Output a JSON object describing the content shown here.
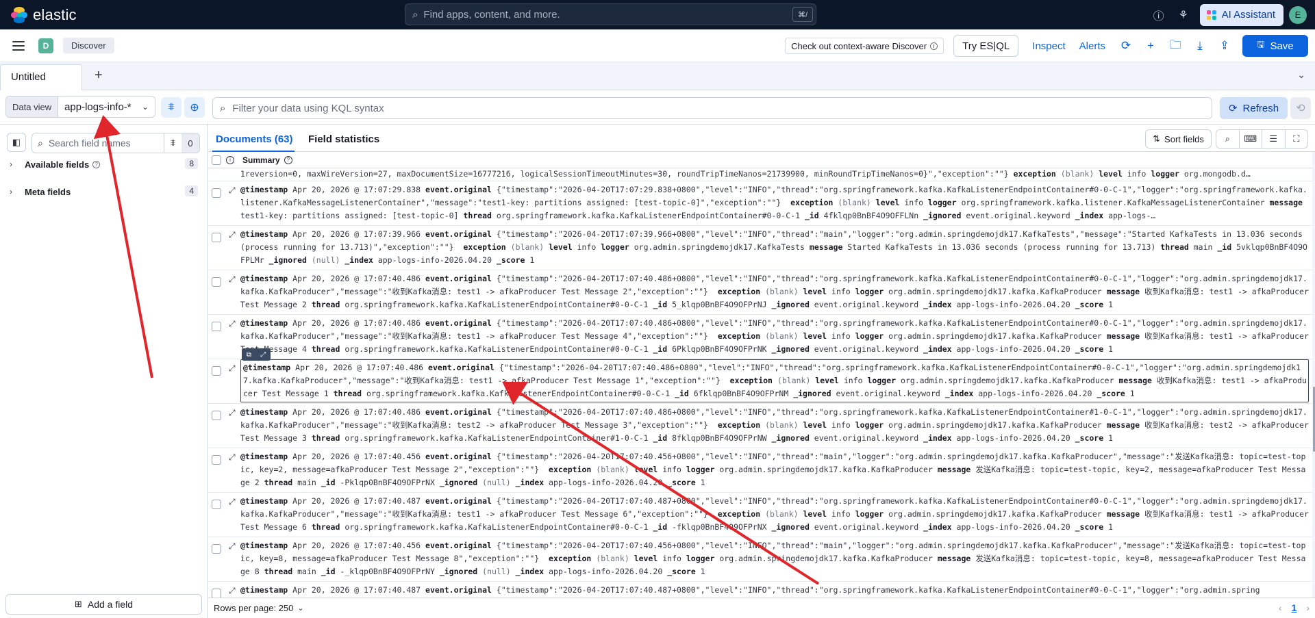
{
  "header": {
    "brand": "elastic",
    "search_placeholder": "Find apps, content, and more.",
    "search_shortcut": "⌘/",
    "ai_assistant_label": "AI Assistant",
    "avatar_initial": "E"
  },
  "toolbar": {
    "space_initial": "D",
    "breadcrumb": "Discover",
    "context_aware_label": "Check out context-aware Discover",
    "try_esql_label": "Try ES|QL",
    "inspect_label": "Inspect",
    "alerts_label": "Alerts",
    "save_label": "Save"
  },
  "tabs": {
    "active_tab": "Untitled",
    "add_icon": "+"
  },
  "query": {
    "data_view_label": "Data view",
    "data_view_value": "app-logs-info-*",
    "kql_placeholder": "Filter your data using KQL syntax",
    "refresh_label": "Refresh"
  },
  "sidebar": {
    "search_placeholder": "Search field names",
    "filter_count": "0",
    "groups": [
      {
        "label": "Available fields",
        "count": "8"
      },
      {
        "label": "Meta fields",
        "count": "4"
      }
    ],
    "add_field_label": "Add a field"
  },
  "main": {
    "tabs": [
      {
        "label": "Documents (63)"
      },
      {
        "label": "Field statistics"
      }
    ],
    "sort_label": "Sort fields",
    "summary_label": "Summary"
  },
  "rows": [
    {
      "parts": [
        [
          "t",
          "1reversion=0, maxWireVersion=27, maxDocumentSize=16777216, logicalSessionTimeoutMinutes=30, roundTripTimeNanos=21739900, minRoundTripTimeNanos=0}\",\"exception\":\"\"} "
        ],
        [
          "b",
          "exception"
        ],
        [
          "t",
          " "
        ],
        [
          "g",
          "(blank)"
        ],
        [
          "t",
          " "
        ],
        [
          "b",
          "level"
        ],
        [
          "t",
          " info "
        ],
        [
          "b",
          "logger"
        ],
        [
          "t",
          " org.mongodb.d…"
        ]
      ]
    },
    {
      "parts": [
        [
          "b",
          "@timestamp"
        ],
        [
          "t",
          " Apr 20, 2026 @ 17:07:29.838 "
        ],
        [
          "b",
          "event.original"
        ],
        [
          "t",
          " {\"timestamp\":\"2026-04-20T17:07:29.838+0800\",\"level\":\"INFO\",\"thread\":\"org.springframework.kafka.KafkaListenerEndpointContainer#0-0-C-1\",\"logger\":\"org.springframework.kafka.listener.KafkaMessageListenerContainer\",\"message\":\"test1-key: partitions assigned: [test-topic-0]\",\"exception\":\"\"}  "
        ],
        [
          "b",
          "exception"
        ],
        [
          "t",
          " "
        ],
        [
          "g",
          "(blank)"
        ],
        [
          "t",
          " "
        ],
        [
          "b",
          "level"
        ],
        [
          "t",
          " info "
        ],
        [
          "b",
          "logger"
        ],
        [
          "t",
          " org.springframework.kafka.listener.KafkaMessageListenerContainer "
        ],
        [
          "b",
          "message"
        ],
        [
          "t",
          " test1-key: partitions assigned: [test-topic-0] "
        ],
        [
          "b",
          "thread"
        ],
        [
          "t",
          " org.springframework.kafka.KafkaListenerEndpointContainer#0-0-C-1 "
        ],
        [
          "b",
          "_id"
        ],
        [
          "t",
          " 4fklqp0BnBF4O9OFFLNn "
        ],
        [
          "b",
          "_ignored"
        ],
        [
          "t",
          " event.original.keyword "
        ],
        [
          "b",
          "_index"
        ],
        [
          "t",
          " app-logs-…"
        ]
      ]
    },
    {
      "parts": [
        [
          "b",
          "@timestamp"
        ],
        [
          "t",
          " Apr 20, 2026 @ 17:07:39.966 "
        ],
        [
          "b",
          "event.original"
        ],
        [
          "t",
          " {\"timestamp\":\"2026-04-20T17:07:39.966+0800\",\"level\":\"INFO\",\"thread\":\"main\",\"logger\":\"org.admin.springdemojdk17.KafkaTests\",\"message\":\"Started KafkaTests in 13.036 seconds (process running for 13.713)\",\"exception\":\"\"}  "
        ],
        [
          "b",
          "exception"
        ],
        [
          "t",
          " "
        ],
        [
          "g",
          "(blank)"
        ],
        [
          "t",
          " "
        ],
        [
          "b",
          "level"
        ],
        [
          "t",
          " info "
        ],
        [
          "b",
          "logger"
        ],
        [
          "t",
          " org.admin.springdemojdk17.KafkaTests "
        ],
        [
          "b",
          "message"
        ],
        [
          "t",
          " Started KafkaTests in 13.036 seconds (process running for 13.713) "
        ],
        [
          "b",
          "thread"
        ],
        [
          "t",
          " main "
        ],
        [
          "b",
          "_id"
        ],
        [
          "t",
          " 5vklqp0BnBF4O9OFPLMr "
        ],
        [
          "b",
          "_ignored"
        ],
        [
          "t",
          " "
        ],
        [
          "g",
          "(null)"
        ],
        [
          "t",
          " "
        ],
        [
          "b",
          "_index"
        ],
        [
          "t",
          " app-logs-info-2026.04.20 "
        ],
        [
          "b",
          "_score"
        ],
        [
          "t",
          " 1"
        ]
      ]
    },
    {
      "parts": [
        [
          "b",
          "@timestamp"
        ],
        [
          "t",
          " Apr 20, 2026 @ 17:07:40.486 "
        ],
        [
          "b",
          "event.original"
        ],
        [
          "t",
          " {\"timestamp\":\"2026-04-20T17:07:40.486+0800\",\"level\":\"INFO\",\"thread\":\"org.springframework.kafka.KafkaListenerEndpointContainer#0-0-C-1\",\"logger\":\"org.admin.springdemojdk17.kafka.KafkaProducer\",\"message\":\"收到Kafka消息: test1 -> afkaProducer Test Message 2\",\"exception\":\"\"}  "
        ],
        [
          "b",
          "exception"
        ],
        [
          "t",
          " "
        ],
        [
          "g",
          "(blank)"
        ],
        [
          "t",
          " "
        ],
        [
          "b",
          "level"
        ],
        [
          "t",
          " info "
        ],
        [
          "b",
          "logger"
        ],
        [
          "t",
          " org.admin.springdemojdk17.kafka.KafkaProducer "
        ],
        [
          "b",
          "message"
        ],
        [
          "t",
          " 收到Kafka消息: test1 -> afkaProducer Test Message 2 "
        ],
        [
          "b",
          "thread"
        ],
        [
          "t",
          " org.springframework.kafka.KafkaListenerEndpointContainer#0-0-C-1 "
        ],
        [
          "b",
          "_id"
        ],
        [
          "t",
          " 5_klqp0BnBF4O9OFPrNJ "
        ],
        [
          "b",
          "_ignored"
        ],
        [
          "t",
          " event.original.keyword "
        ],
        [
          "b",
          "_index"
        ],
        [
          "t",
          " app-logs-info-2026.04.20 "
        ],
        [
          "b",
          "_score"
        ],
        [
          "t",
          " 1"
        ]
      ]
    },
    {
      "parts": [
        [
          "b",
          "@timestamp"
        ],
        [
          "t",
          " Apr 20, 2026 @ 17:07:40.486 "
        ],
        [
          "b",
          "event.original"
        ],
        [
          "t",
          " {\"timestamp\":\"2026-04-20T17:07:40.486+0800\",\"level\":\"INFO\",\"thread\":\"org.springframework.kafka.KafkaListenerEndpointContainer#0-0-C-1\",\"logger\":\"org.admin.springdemojdk17.kafka.KafkaProducer\",\"message\":\"收到Kafka消息: test1 -> afkaProducer Test Message 4\",\"exception\":\"\"}  "
        ],
        [
          "b",
          "exception"
        ],
        [
          "t",
          " "
        ],
        [
          "g",
          "(blank)"
        ],
        [
          "t",
          " "
        ],
        [
          "b",
          "level"
        ],
        [
          "t",
          " info "
        ],
        [
          "b",
          "logger"
        ],
        [
          "t",
          " org.admin.springdemojdk17.kafka.KafkaProducer "
        ],
        [
          "b",
          "message"
        ],
        [
          "t",
          " 收到Kafka消息: test1 -> afkaProducer Test Message 4 "
        ],
        [
          "b",
          "thread"
        ],
        [
          "t",
          " org.springframework.kafka.KafkaListenerEndpointContainer#0-0-C-1 "
        ],
        [
          "b",
          "_id"
        ],
        [
          "t",
          " 6Pklqp0BnBF4O9OFPrNK "
        ],
        [
          "b",
          "_ignored"
        ],
        [
          "t",
          " event.original.keyword "
        ],
        [
          "b",
          "_index"
        ],
        [
          "t",
          " app-logs-info-2026.04.20 "
        ],
        [
          "b",
          "_score"
        ],
        [
          "t",
          " 1"
        ]
      ]
    },
    {
      "focused": true,
      "parts": [
        [
          "b",
          "@timestamp"
        ],
        [
          "t",
          " Apr 20, 2026 @ 17:07:40.486 "
        ],
        [
          "b",
          "event.original"
        ],
        [
          "t",
          " {\"timestamp\":\"2026-04-20T17:07:40.486+0800\",\"level\":\"INFO\",\"thread\":\"org.springframework.kafka.KafkaListenerEndpointContainer#0-0-C-1\",\"logger\":\"org.admin.springdemojdk17.kafka.KafkaProducer\",\"message\":\"收到Kafka消息: test1 -> afkaProducer Test Message 1\",\"exception\":\"\"}  "
        ],
        [
          "b",
          "exception"
        ],
        [
          "t",
          " "
        ],
        [
          "g",
          "(blank)"
        ],
        [
          "t",
          " "
        ],
        [
          "b",
          "level"
        ],
        [
          "t",
          " info "
        ],
        [
          "b",
          "logger"
        ],
        [
          "t",
          " org.admin.springdemojdk17.kafka.KafkaProducer "
        ],
        [
          "b",
          "message"
        ],
        [
          "t",
          " 收到Kafka消息: test1 -> afkaProducer Test Message 1 "
        ],
        [
          "b",
          "thread"
        ],
        [
          "t",
          " org.springframework.kafka.KafkaListenerEndpointContainer#0-0-C-1 "
        ],
        [
          "b",
          "_id"
        ],
        [
          "t",
          " 6fklqp0BnBF4O9OFPrNM "
        ],
        [
          "b",
          "_ignored"
        ],
        [
          "t",
          " event.original.keyword "
        ],
        [
          "b",
          "_index"
        ],
        [
          "t",
          " app-logs-info-2026.04.20 "
        ],
        [
          "b",
          "_score"
        ],
        [
          "t",
          " 1"
        ]
      ]
    },
    {
      "parts": [
        [
          "b",
          "@timestamp"
        ],
        [
          "t",
          " Apr 20, 2026 @ 17:07:40.486 "
        ],
        [
          "b",
          "event.original"
        ],
        [
          "t",
          " {\"timestamp\":\"2026-04-20T17:07:40.486+0800\",\"level\":\"INFO\",\"thread\":\"org.springframework.kafka.KafkaListenerEndpointContainer#1-0-C-1\",\"logger\":\"org.admin.springdemojdk17.kafka.KafkaProducer\",\"message\":\"收到Kafka消息: test2 -> afkaProducer Test Message 3\",\"exception\":\"\"}  "
        ],
        [
          "b",
          "exception"
        ],
        [
          "t",
          " "
        ],
        [
          "g",
          "(blank)"
        ],
        [
          "t",
          " "
        ],
        [
          "b",
          "level"
        ],
        [
          "t",
          " info "
        ],
        [
          "b",
          "logger"
        ],
        [
          "t",
          " org.admin.springdemojdk17.kafka.KafkaProducer "
        ],
        [
          "b",
          "message"
        ],
        [
          "t",
          " 收到Kafka消息: test2 -> afkaProducer Test Message 3 "
        ],
        [
          "b",
          "thread"
        ],
        [
          "t",
          " org.springframework.kafka.KafkaListenerEndpointContainer#1-0-C-1 "
        ],
        [
          "b",
          "_id"
        ],
        [
          "t",
          " 8fklqp0BnBF4O9OFPrNW "
        ],
        [
          "b",
          "_ignored"
        ],
        [
          "t",
          " event.original.keyword "
        ],
        [
          "b",
          "_index"
        ],
        [
          "t",
          " app-logs-info-2026.04.20 "
        ],
        [
          "b",
          "_score"
        ],
        [
          "t",
          " 1"
        ]
      ]
    },
    {
      "parts": [
        [
          "b",
          "@timestamp"
        ],
        [
          "t",
          " Apr 20, 2026 @ 17:07:40.456 "
        ],
        [
          "b",
          "event.original"
        ],
        [
          "t",
          " {\"timestamp\":\"2026-04-20T17:07:40.456+0800\",\"level\":\"INFO\",\"thread\":\"main\",\"logger\":\"org.admin.springdemojdk17.kafka.KafkaProducer\",\"message\":\"发送Kafka消息: topic=test-topic, key=2, message=afkaProducer Test Message 2\",\"exception\":\"\"}  "
        ],
        [
          "b",
          "exception"
        ],
        [
          "t",
          " "
        ],
        [
          "g",
          "(blank)"
        ],
        [
          "t",
          " "
        ],
        [
          "b",
          "level"
        ],
        [
          "t",
          " info "
        ],
        [
          "b",
          "logger"
        ],
        [
          "t",
          " org.admin.springdemojdk17.kafka.KafkaProducer "
        ],
        [
          "b",
          "message"
        ],
        [
          "t",
          " 发送Kafka消息: topic=test-topic, key=2, message=afkaProducer Test Message 2 "
        ],
        [
          "b",
          "thread"
        ],
        [
          "t",
          " main "
        ],
        [
          "b",
          "_id"
        ],
        [
          "t",
          " -Pklqp0BnBF4O9OFPrNX "
        ],
        [
          "b",
          "_ignored"
        ],
        [
          "t",
          " "
        ],
        [
          "g",
          "(null)"
        ],
        [
          "t",
          " "
        ],
        [
          "b",
          "_index"
        ],
        [
          "t",
          " app-logs-info-2026.04.20 "
        ],
        [
          "b",
          "_score"
        ],
        [
          "t",
          " 1"
        ]
      ]
    },
    {
      "parts": [
        [
          "b",
          "@timestamp"
        ],
        [
          "t",
          " Apr 20, 2026 @ 17:07:40.487 "
        ],
        [
          "b",
          "event.original"
        ],
        [
          "t",
          " {\"timestamp\":\"2026-04-20T17:07:40.487+0800\",\"level\":\"INFO\",\"thread\":\"org.springframework.kafka.KafkaListenerEndpointContainer#0-0-C-1\",\"logger\":\"org.admin.springdemojdk17.kafka.KafkaProducer\",\"message\":\"收到Kafka消息: test1 -> afkaProducer Test Message 6\",\"exception\":\"\"}  "
        ],
        [
          "b",
          "exception"
        ],
        [
          "t",
          " "
        ],
        [
          "g",
          "(blank)"
        ],
        [
          "t",
          " "
        ],
        [
          "b",
          "level"
        ],
        [
          "t",
          " info "
        ],
        [
          "b",
          "logger"
        ],
        [
          "t",
          " org.admin.springdemojdk17.kafka.KafkaProducer "
        ],
        [
          "b",
          "message"
        ],
        [
          "t",
          " 收到Kafka消息: test1 -> afkaProducer Test Message 6 "
        ],
        [
          "b",
          "thread"
        ],
        [
          "t",
          " org.springframework.kafka.KafkaListenerEndpointContainer#0-0-C-1 "
        ],
        [
          "b",
          "_id"
        ],
        [
          "t",
          " -fklqp0BnBF4O9OFPrNX "
        ],
        [
          "b",
          "_ignored"
        ],
        [
          "t",
          " event.original.keyword "
        ],
        [
          "b",
          "_index"
        ],
        [
          "t",
          " app-logs-info-2026.04.20 "
        ],
        [
          "b",
          "_score"
        ],
        [
          "t",
          " 1"
        ]
      ]
    },
    {
      "parts": [
        [
          "b",
          "@timestamp"
        ],
        [
          "t",
          " Apr 20, 2026 @ 17:07:40.456 "
        ],
        [
          "b",
          "event.original"
        ],
        [
          "t",
          " {\"timestamp\":\"2026-04-20T17:07:40.456+0800\",\"level\":\"INFO\",\"thread\":\"main\",\"logger\":\"org.admin.springdemojdk17.kafka.KafkaProducer\",\"message\":\"发送Kafka消息: topic=test-topic, key=8, message=afkaProducer Test Message 8\",\"exception\":\"\"}  "
        ],
        [
          "b",
          "exception"
        ],
        [
          "t",
          " "
        ],
        [
          "g",
          "(blank)"
        ],
        [
          "t",
          " "
        ],
        [
          "b",
          "level"
        ],
        [
          "t",
          " info "
        ],
        [
          "b",
          "logger"
        ],
        [
          "t",
          " org.admin.springdemojdk17.kafka.KafkaProducer "
        ],
        [
          "b",
          "message"
        ],
        [
          "t",
          " 发送Kafka消息: topic=test-topic, key=8, message=afkaProducer Test Message 8 "
        ],
        [
          "b",
          "thread"
        ],
        [
          "t",
          " main "
        ],
        [
          "b",
          "_id"
        ],
        [
          "t",
          " -_klqp0BnBF4O9OFPrNY "
        ],
        [
          "b",
          "_ignored"
        ],
        [
          "t",
          " "
        ],
        [
          "g",
          "(null)"
        ],
        [
          "t",
          " "
        ],
        [
          "b",
          "_index"
        ],
        [
          "t",
          " app-logs-info-2026.04.20 "
        ],
        [
          "b",
          "_score"
        ],
        [
          "t",
          " 1"
        ]
      ]
    },
    {
      "parts": [
        [
          "b",
          "@timestamp"
        ],
        [
          "t",
          " Apr 20, 2026 @ 17:07:40.487 "
        ],
        [
          "b",
          "event.original"
        ],
        [
          "t",
          " {\"timestamp\":\"2026-04-20T17:07:40.487+0800\",\"level\":\"INFO\",\"thread\":\"org.springframework.kafka.KafkaListenerEndpointContainer#0-0-C-1\",\"logger\":\"org.admin.spring"
        ]
      ]
    }
  ],
  "pagination": {
    "rows_per_page": "Rows per page: 250",
    "current_page": "1"
  },
  "colors": {
    "header_bg": "#0b1628",
    "accent": "#0b64dd",
    "annotation": "#e0252b"
  }
}
